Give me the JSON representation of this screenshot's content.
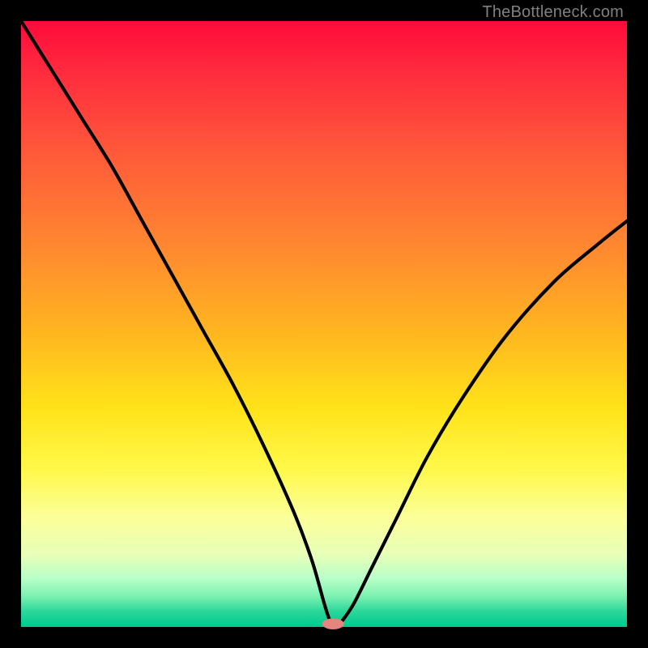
{
  "watermark": "TheBottleneck.com",
  "colors": {
    "curve": "#000000",
    "marker": "#e5857d",
    "frame": "#000000"
  },
  "chart_data": {
    "type": "line",
    "title": "",
    "xlabel": "",
    "ylabel": "",
    "xlim": [
      0,
      100
    ],
    "ylim": [
      0,
      100
    ],
    "grid": false,
    "legend": false,
    "notes": "V-shaped bottleneck curve over vertical red→green gradient. Axes unlabeled; values read as percentages of plot area.",
    "series": [
      {
        "name": "bottleneck-curve",
        "x": [
          0,
          5,
          10,
          15,
          20,
          25,
          30,
          35,
          40,
          45,
          48,
          50,
          51,
          52,
          53,
          55,
          58,
          62,
          67,
          73,
          80,
          88,
          95,
          100
        ],
        "y": [
          100,
          92,
          84,
          76,
          67,
          58,
          49,
          40,
          30,
          19,
          11,
          4,
          1,
          0,
          1,
          4,
          10,
          18,
          28,
          38,
          48,
          57,
          63,
          67
        ]
      }
    ],
    "marker": {
      "x": 51.5,
      "y": 0.5,
      "rx": 1.8,
      "ry": 0.9
    }
  }
}
